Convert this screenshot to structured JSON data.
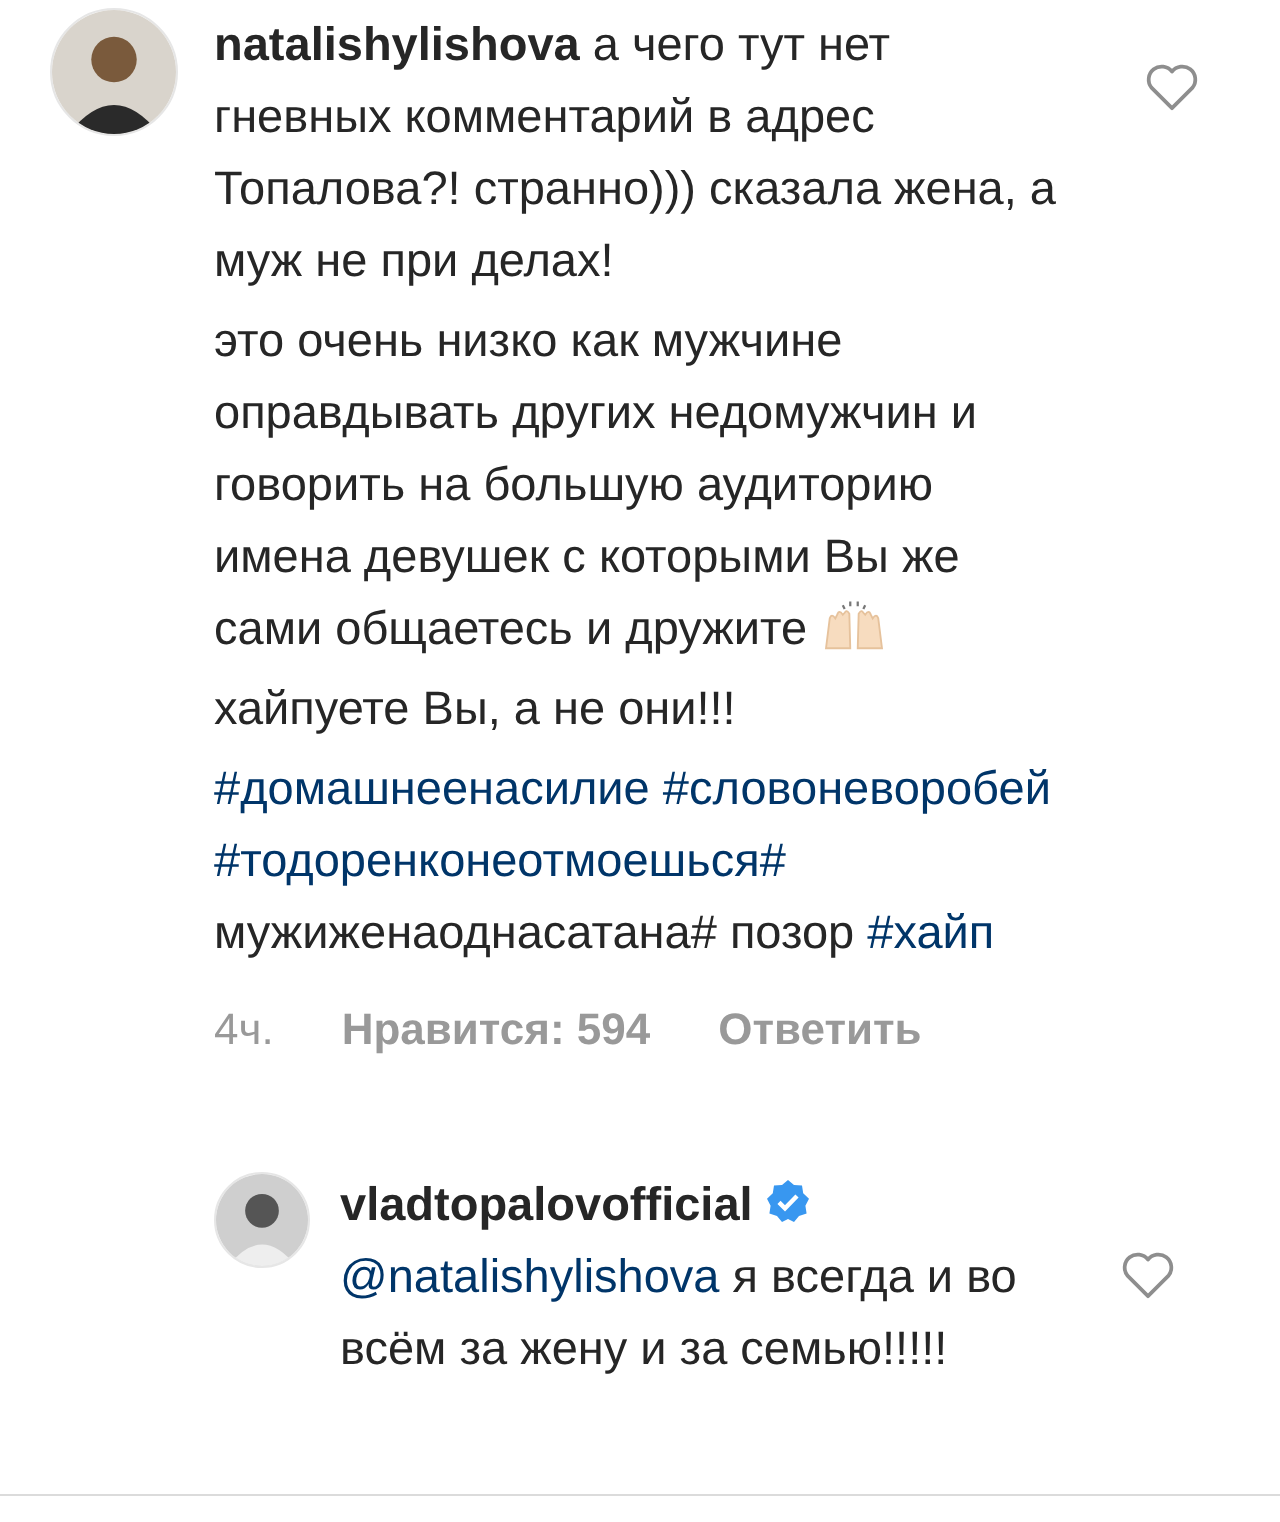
{
  "comments": [
    {
      "username": "natalishylishova",
      "verified": false,
      "liked": false,
      "paragraphs": [
        [
          {
            "kind": "text",
            "text": "а чего тут нет гневных комментарий в адрес Топалова?! странно))) сказала жена, а муж не при делах!"
          }
        ],
        [
          {
            "kind": "text",
            "text": "это очень низко как мужчине оправдывать других недомужчин и говорить на большую аудиторию имена девушек с которыми Вы же сами общаетесь и дружите "
          },
          {
            "kind": "emoji"
          }
        ],
        [
          {
            "kind": "text",
            "text": "хайпуете Вы, а не они!!!"
          }
        ],
        [
          {
            "kind": "hashtag",
            "text": "#домашнеенасилие"
          },
          {
            "kind": "space"
          },
          {
            "kind": "hashtag",
            "text": "#словоневоробей"
          },
          {
            "kind": "space"
          },
          {
            "kind": "hashtag",
            "text": "#тодоренконеотмоешься#"
          },
          {
            "kind": "text",
            "text": " мужиженаоднасатана# позор "
          },
          {
            "kind": "hashtag",
            "text": "#хайп"
          }
        ]
      ],
      "time": "4ч.",
      "likes": "Нравится: 594",
      "reply": "Ответить"
    },
    {
      "username": "vladtopalovofficial",
      "verified": true,
      "liked": false,
      "paragraphs": [
        [
          {
            "kind": "mention",
            "text": "@natalishylishova"
          },
          {
            "kind": "text",
            "text": " я всегда и во всём за жену и за семью!!!!!"
          }
        ]
      ]
    }
  ]
}
